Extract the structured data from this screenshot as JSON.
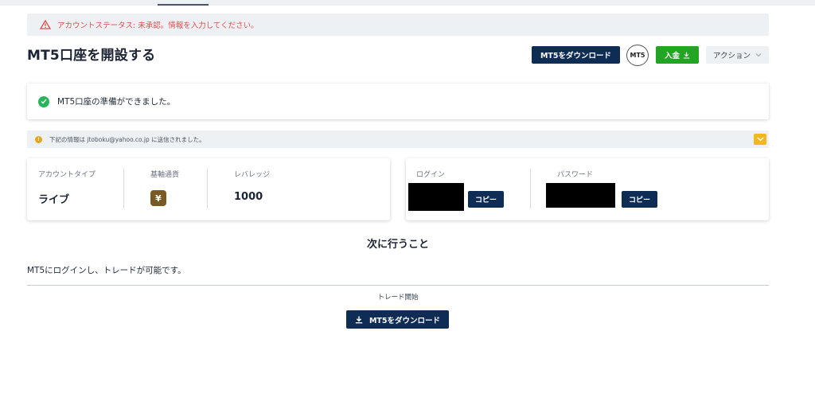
{
  "alert": {
    "text": "アカウントステータス: 未承認。情報を入力してください。"
  },
  "page": {
    "title": "MT5口座を開設する"
  },
  "header": {
    "download_label": "MT5をダウンロード",
    "logo_text": "MT5",
    "deposit_label": "入金",
    "action_label": "アクション"
  },
  "ready": {
    "text": "MT5口座の準備ができました。"
  },
  "info": {
    "text": "下記の情報は jtoboku@yahoo.co.jp に送信されました。"
  },
  "account": {
    "type_label": "アカウントタイプ",
    "type_value": "ライブ",
    "currency_label": "基軸通貨",
    "currency_symbol": "¥",
    "leverage_label": "レバレッジ",
    "leverage_value": "1000"
  },
  "credentials": {
    "login_label": "ログイン",
    "password_label": "パスワード",
    "copy_label": "コピー"
  },
  "next": {
    "title": "次に行うこと",
    "description": "MT5にログインし、トレードが可能です。",
    "trade_label": "トレード開始",
    "download_label": "MT5をダウンロード"
  },
  "colors": {
    "primary": "#0f2c55",
    "success": "#22a522",
    "alert_text": "#e24b4b",
    "check": "#27b45a",
    "info": "#e8a317"
  }
}
